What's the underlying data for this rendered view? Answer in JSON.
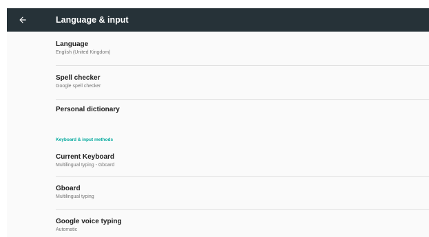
{
  "colors": {
    "toolbar": "#263238",
    "accent": "#00a99d",
    "background": "#fafafa"
  },
  "toolbar": {
    "back_icon": "arrow-back-icon",
    "title": "Language & input"
  },
  "items": [
    {
      "title": "Language",
      "summary": "English (United Kingdom)"
    },
    {
      "title": "Spell checker",
      "summary": "Google spell checker"
    },
    {
      "title": "Personal dictionary",
      "summary": ""
    }
  ],
  "section": {
    "header": "Keyboard & input methods"
  },
  "keyboard_items": [
    {
      "title": "Current Keyboard",
      "summary": "Multilingual typing - Gboard"
    },
    {
      "title": "Gboard",
      "summary": "Multilingual typing"
    },
    {
      "title": "Google voice typing",
      "summary": "Automatic"
    }
  ]
}
